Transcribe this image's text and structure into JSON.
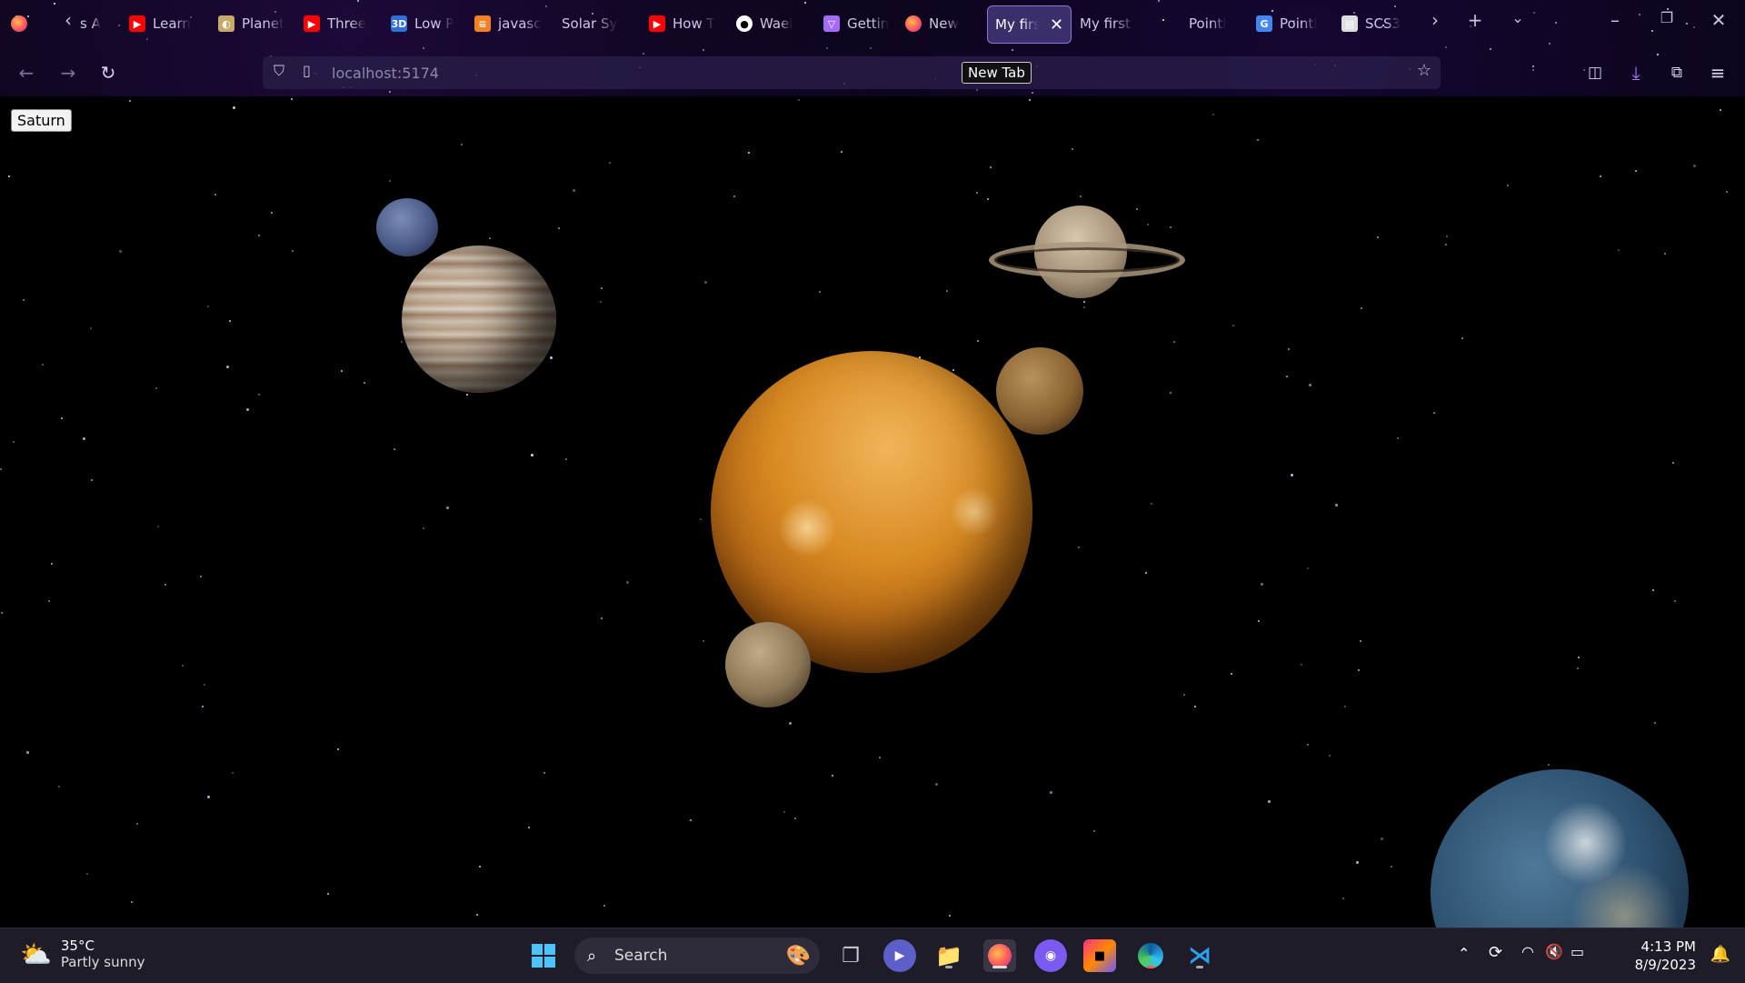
{
  "browser": {
    "tabs": [
      {
        "label": "s A",
        "favicon": "scroll-left-partial",
        "color": "#6b6b8a"
      },
      {
        "label": "Learn",
        "favicon": "youtube-icon",
        "color": "#ff0000"
      },
      {
        "label": "Planet",
        "favicon": "planet-icon",
        "color": "#c9a96a"
      },
      {
        "label": "Three",
        "favicon": "youtube-icon",
        "color": "#ff0000"
      },
      {
        "label": "Low P",
        "favicon": "3d-icon",
        "color": "#2f6fd6"
      },
      {
        "label": "javasc",
        "favicon": "stackoverflow-icon",
        "color": "#f48024"
      },
      {
        "label": "Solar Sys",
        "favicon": "none",
        "color": "#000000"
      },
      {
        "label": "How T",
        "favicon": "youtube-icon",
        "color": "#ff0000"
      },
      {
        "label": "Wael",
        "favicon": "github-icon",
        "color": "#ffffff"
      },
      {
        "label": "Gettin",
        "favicon": "vite-icon",
        "color": "#a46bff"
      },
      {
        "label": "New",
        "favicon": "firefox-icon",
        "color": "#ff7139"
      },
      {
        "label": "My first",
        "favicon": "none",
        "color": "#000000",
        "active": true
      },
      {
        "label": "My first th",
        "favicon": "none",
        "color": "#000000"
      },
      {
        "label": "Pointl",
        "favicon": "none",
        "color": "#000000"
      },
      {
        "label": "Pointl",
        "favicon": "google-icon",
        "color": "#4285f4"
      },
      {
        "label": "SCS3",
        "favicon": "page-icon",
        "color": "#dddddd"
      }
    ],
    "url": "localhost:5174",
    "tooltip": "New Tab"
  },
  "scene": {
    "button_label": "Saturn"
  },
  "taskbar": {
    "weather": {
      "temp": "35°C",
      "condition": "Partly sunny"
    },
    "search_label": "Search",
    "apps": [
      "task-view",
      "teams-chat",
      "file-explorer",
      "firefox",
      "github-desktop",
      "jetbrains-toolbox",
      "edge",
      "vscode"
    ],
    "time": "4:13 PM",
    "date": "8/9/2023"
  },
  "colors": {
    "chrome_bg": "#0a0416",
    "active_tab": "#3a2f6a",
    "taskbar_bg": "#1f1c2a"
  }
}
